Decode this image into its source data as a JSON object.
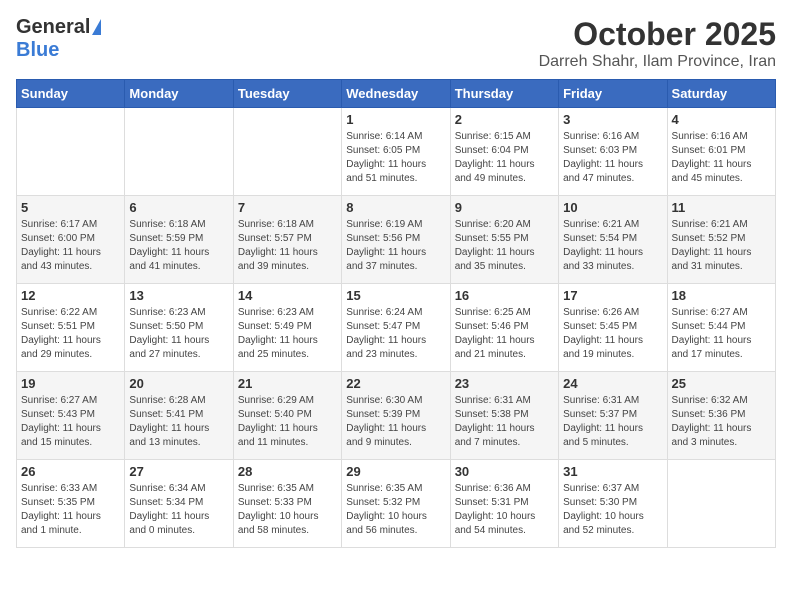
{
  "header": {
    "logo_general": "General",
    "logo_blue": "Blue",
    "month": "October 2025",
    "location": "Darreh Shahr, Ilam Province, Iran"
  },
  "days_of_week": [
    "Sunday",
    "Monday",
    "Tuesday",
    "Wednesday",
    "Thursday",
    "Friday",
    "Saturday"
  ],
  "weeks": [
    [
      {
        "day": "",
        "info": ""
      },
      {
        "day": "",
        "info": ""
      },
      {
        "day": "",
        "info": ""
      },
      {
        "day": "1",
        "info": "Sunrise: 6:14 AM\nSunset: 6:05 PM\nDaylight: 11 hours\nand 51 minutes."
      },
      {
        "day": "2",
        "info": "Sunrise: 6:15 AM\nSunset: 6:04 PM\nDaylight: 11 hours\nand 49 minutes."
      },
      {
        "day": "3",
        "info": "Sunrise: 6:16 AM\nSunset: 6:03 PM\nDaylight: 11 hours\nand 47 minutes."
      },
      {
        "day": "4",
        "info": "Sunrise: 6:16 AM\nSunset: 6:01 PM\nDaylight: 11 hours\nand 45 minutes."
      }
    ],
    [
      {
        "day": "5",
        "info": "Sunrise: 6:17 AM\nSunset: 6:00 PM\nDaylight: 11 hours\nand 43 minutes."
      },
      {
        "day": "6",
        "info": "Sunrise: 6:18 AM\nSunset: 5:59 PM\nDaylight: 11 hours\nand 41 minutes."
      },
      {
        "day": "7",
        "info": "Sunrise: 6:18 AM\nSunset: 5:57 PM\nDaylight: 11 hours\nand 39 minutes."
      },
      {
        "day": "8",
        "info": "Sunrise: 6:19 AM\nSunset: 5:56 PM\nDaylight: 11 hours\nand 37 minutes."
      },
      {
        "day": "9",
        "info": "Sunrise: 6:20 AM\nSunset: 5:55 PM\nDaylight: 11 hours\nand 35 minutes."
      },
      {
        "day": "10",
        "info": "Sunrise: 6:21 AM\nSunset: 5:54 PM\nDaylight: 11 hours\nand 33 minutes."
      },
      {
        "day": "11",
        "info": "Sunrise: 6:21 AM\nSunset: 5:52 PM\nDaylight: 11 hours\nand 31 minutes."
      }
    ],
    [
      {
        "day": "12",
        "info": "Sunrise: 6:22 AM\nSunset: 5:51 PM\nDaylight: 11 hours\nand 29 minutes."
      },
      {
        "day": "13",
        "info": "Sunrise: 6:23 AM\nSunset: 5:50 PM\nDaylight: 11 hours\nand 27 minutes."
      },
      {
        "day": "14",
        "info": "Sunrise: 6:23 AM\nSunset: 5:49 PM\nDaylight: 11 hours\nand 25 minutes."
      },
      {
        "day": "15",
        "info": "Sunrise: 6:24 AM\nSunset: 5:47 PM\nDaylight: 11 hours\nand 23 minutes."
      },
      {
        "day": "16",
        "info": "Sunrise: 6:25 AM\nSunset: 5:46 PM\nDaylight: 11 hours\nand 21 minutes."
      },
      {
        "day": "17",
        "info": "Sunrise: 6:26 AM\nSunset: 5:45 PM\nDaylight: 11 hours\nand 19 minutes."
      },
      {
        "day": "18",
        "info": "Sunrise: 6:27 AM\nSunset: 5:44 PM\nDaylight: 11 hours\nand 17 minutes."
      }
    ],
    [
      {
        "day": "19",
        "info": "Sunrise: 6:27 AM\nSunset: 5:43 PM\nDaylight: 11 hours\nand 15 minutes."
      },
      {
        "day": "20",
        "info": "Sunrise: 6:28 AM\nSunset: 5:41 PM\nDaylight: 11 hours\nand 13 minutes."
      },
      {
        "day": "21",
        "info": "Sunrise: 6:29 AM\nSunset: 5:40 PM\nDaylight: 11 hours\nand 11 minutes."
      },
      {
        "day": "22",
        "info": "Sunrise: 6:30 AM\nSunset: 5:39 PM\nDaylight: 11 hours\nand 9 minutes."
      },
      {
        "day": "23",
        "info": "Sunrise: 6:31 AM\nSunset: 5:38 PM\nDaylight: 11 hours\nand 7 minutes."
      },
      {
        "day": "24",
        "info": "Sunrise: 6:31 AM\nSunset: 5:37 PM\nDaylight: 11 hours\nand 5 minutes."
      },
      {
        "day": "25",
        "info": "Sunrise: 6:32 AM\nSunset: 5:36 PM\nDaylight: 11 hours\nand 3 minutes."
      }
    ],
    [
      {
        "day": "26",
        "info": "Sunrise: 6:33 AM\nSunset: 5:35 PM\nDaylight: 11 hours\nand 1 minute."
      },
      {
        "day": "27",
        "info": "Sunrise: 6:34 AM\nSunset: 5:34 PM\nDaylight: 11 hours\nand 0 minutes."
      },
      {
        "day": "28",
        "info": "Sunrise: 6:35 AM\nSunset: 5:33 PM\nDaylight: 10 hours\nand 58 minutes."
      },
      {
        "day": "29",
        "info": "Sunrise: 6:35 AM\nSunset: 5:32 PM\nDaylight: 10 hours\nand 56 minutes."
      },
      {
        "day": "30",
        "info": "Sunrise: 6:36 AM\nSunset: 5:31 PM\nDaylight: 10 hours\nand 54 minutes."
      },
      {
        "day": "31",
        "info": "Sunrise: 6:37 AM\nSunset: 5:30 PM\nDaylight: 10 hours\nand 52 minutes."
      },
      {
        "day": "",
        "info": ""
      }
    ]
  ]
}
